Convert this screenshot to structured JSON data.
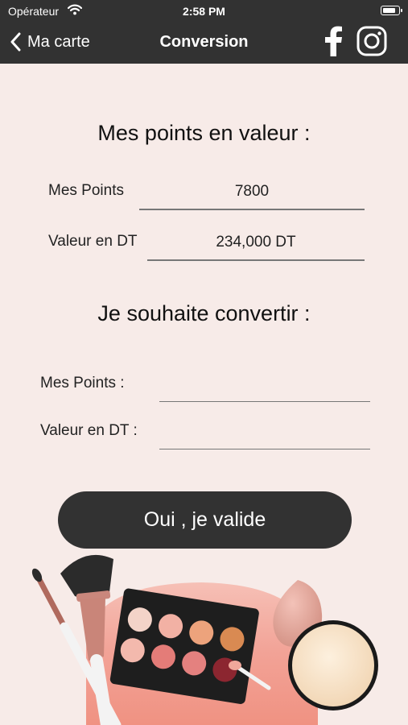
{
  "status_bar": {
    "carrier": "Opérateur",
    "time": "2:58 PM",
    "battery_level": 0.9
  },
  "nav": {
    "back_label": "Ma carte",
    "title": "Conversion"
  },
  "points_section": {
    "heading": "Mes points en valeur :",
    "points_label": "Mes Points",
    "points_value": "7800",
    "dt_label": "Valeur en DT",
    "dt_value": "234,000 DT"
  },
  "convert_section": {
    "heading": "Je souhaite convertir :",
    "points_label": "Mes Points :",
    "points_input_value": "",
    "dt_label": "Valeur en DT :",
    "dt_input_value": ""
  },
  "submit_label": "Oui , je valide",
  "colors": {
    "bar": "#323232",
    "background": "#f7ebe8",
    "button": "#323232",
    "decor_pink": "#f2a296"
  },
  "icons": [
    "back-chevron-icon",
    "facebook-icon",
    "instagram-icon",
    "wifi-icon",
    "battery-icon"
  ]
}
